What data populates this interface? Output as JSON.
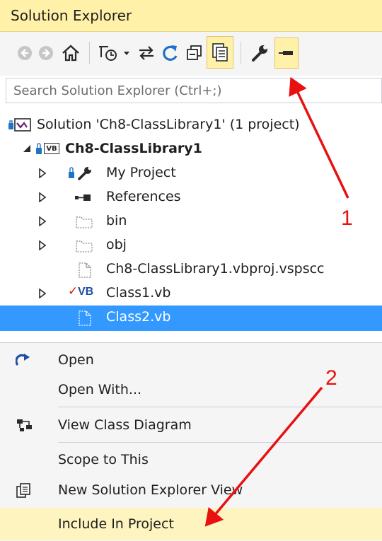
{
  "panel": {
    "title": "Solution Explorer"
  },
  "toolbar": {
    "buttons": [
      "back-icon",
      "forward-icon",
      "home-icon",
      "pending-changes-filter-icon",
      "sync-icon",
      "refresh-icon",
      "collapse-all-icon",
      "show-all-files-icon",
      "properties-icon",
      "pin-icon"
    ]
  },
  "search": {
    "placeholder": "Search Solution Explorer (Ctrl+;)",
    "value": ""
  },
  "tree": {
    "solution": "Solution 'Ch8-ClassLibrary1' (1 project)",
    "project": "Ch8-ClassLibrary1",
    "project_badge": "VB",
    "items": [
      {
        "label": "My Project"
      },
      {
        "label": "References"
      },
      {
        "label": "bin"
      },
      {
        "label": "obj"
      },
      {
        "label": "Ch8-ClassLibrary1.vbproj.vspscc"
      },
      {
        "label": "Class1.vb",
        "badge": "VB",
        "status": "✓"
      },
      {
        "label": "Class2.vb",
        "selected": true
      }
    ]
  },
  "context_menu": {
    "items": [
      {
        "label": "Open"
      },
      {
        "label": "Open With..."
      },
      {
        "label": "View Class Diagram"
      },
      {
        "label": "Scope to This"
      },
      {
        "label": "New Solution Explorer View"
      },
      {
        "label": "Include In Project",
        "highlighted": true
      }
    ]
  },
  "annotations": {
    "one": "1",
    "two": "2"
  },
  "colors": {
    "title_bg": "#fff1a8",
    "selection": "#3399ff",
    "menu_highlight": "#fdf4bf",
    "annotation": "#e81010"
  }
}
